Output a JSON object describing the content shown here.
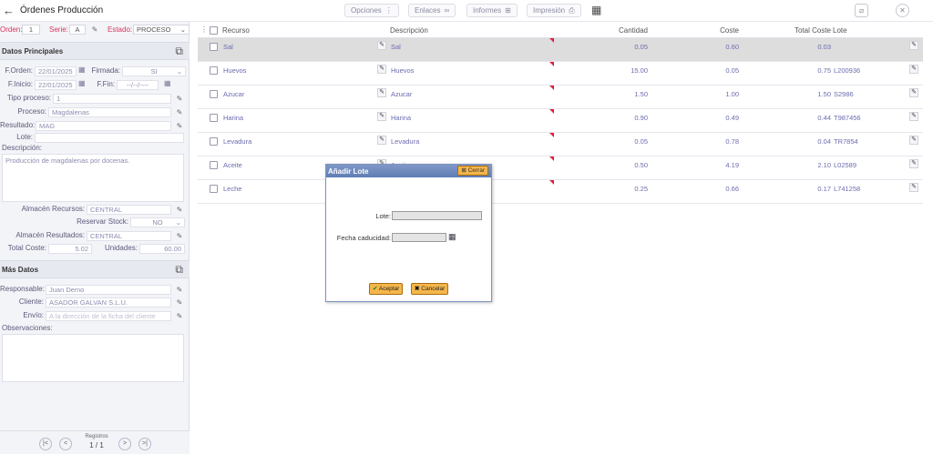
{
  "header": {
    "back_glyph": "←",
    "title": "Órdenes Producción",
    "buttons": [
      {
        "label": "Opciones",
        "glyph": "⋮"
      },
      {
        "label": "Enlaces",
        "glyph": "∞"
      },
      {
        "label": "Informes",
        "glyph": "⊞"
      },
      {
        "label": "Impresión",
        "glyph": "⎙"
      }
    ],
    "barcode_glyph": "▦",
    "right_icon_1": "⧄",
    "right_icon_2": "✕"
  },
  "order": {
    "orden_label": "Orden:",
    "orden_value": "1",
    "serie_label": "Serie:",
    "serie_value": "A",
    "estado_label": "Estado:",
    "estado_value": "PROCESO"
  },
  "datos_principales": {
    "title": "Datos Principales",
    "forden_label": "F.Orden:",
    "forden_value": "22/01/2025",
    "firmada_label": "Firmada:",
    "firmada_value": "SI",
    "finicio_label": "F.Inicio:",
    "finicio_value": "22/01/2025",
    "ffin_label": "F.Fin:",
    "ffin_value": "--/--/----",
    "tipo_label": "Tipo proceso:",
    "tipo_value": "1",
    "proceso_label": "Proceso:",
    "proceso_value": "Magdalenas",
    "resultado_label": "Resultado:",
    "resultado_value": "MAG",
    "lote_label": "Lote:",
    "lote_value": "",
    "descripcion_label": "Descripción:",
    "descripcion_value": "Producción de magdalenas por docenas.",
    "almrec_label": "Almacén Recursos:",
    "almrec_value": "CENTRAL",
    "reservar_label": "Reservar Stock:",
    "reservar_value": "NO",
    "almres_label": "Almacén Resultados:",
    "almres_value": "CENTRAL",
    "coste_label": "Total Coste:",
    "coste_value": "5.02",
    "unidades_label": "Unidades:",
    "unidades_value": "60.00"
  },
  "mas_datos": {
    "title": "Más Datos",
    "responsable_label": "Responsable:",
    "responsable_value": "Juan Demo",
    "cliente_label": "Cliente:",
    "cliente_value": "ASADOR GALVAN S.L.U.",
    "envio_label": "Envío:",
    "envio_placeholder": "A la dirección de la ficha del cliente",
    "observaciones_label": "Observaciones:"
  },
  "pager": {
    "registros_label": "Registros",
    "registros_value": "1 / 1"
  },
  "grid": {
    "headers": {
      "recurso": "Recurso",
      "descripcion": "Descripción",
      "cantidad": "Cantidad",
      "coste": "Coste",
      "total_coste": "Total Coste",
      "lote": "Lote"
    },
    "rows": [
      {
        "recurso": "Sal",
        "descripcion": "Sal",
        "cantidad": "0.05",
        "coste": "0.60",
        "total": "0.03",
        "lote": ""
      },
      {
        "recurso": "Huevos",
        "descripcion": "Huevos",
        "cantidad": "15.00",
        "coste": "0.05",
        "total": "0.75",
        "lote": "L200936"
      },
      {
        "recurso": "Azucar",
        "descripcion": "Azucar",
        "cantidad": "1.50",
        "coste": "1.00",
        "total": "1.50",
        "lote": "S2986"
      },
      {
        "recurso": "Harina",
        "descripcion": "Harina",
        "cantidad": "0.90",
        "coste": "0.49",
        "total": "0.44",
        "lote": "T987456"
      },
      {
        "recurso": "Levadura",
        "descripcion": "Levadura",
        "cantidad": "0.05",
        "coste": "0.78",
        "total": "0.04",
        "lote": "TR7854"
      },
      {
        "recurso": "Aceite",
        "descripcion": "Aceite",
        "cantidad": "0.50",
        "coste": "4.19",
        "total": "2.10",
        "lote": "L02589"
      },
      {
        "recurso": "Leche",
        "descripcion": "",
        "cantidad": "0.25",
        "coste": "0.66",
        "total": "0.17",
        "lote": "L741258"
      }
    ]
  },
  "dialog": {
    "title": "Añadir Lote",
    "cerrar_label": "Cerrar",
    "lote_label": "Lote:",
    "lote_value": "",
    "fecha_label": "Fecha caducidad:",
    "fecha_value": "",
    "aceptar_label": "Aceptar",
    "cancelar_label": "Cancelar"
  }
}
